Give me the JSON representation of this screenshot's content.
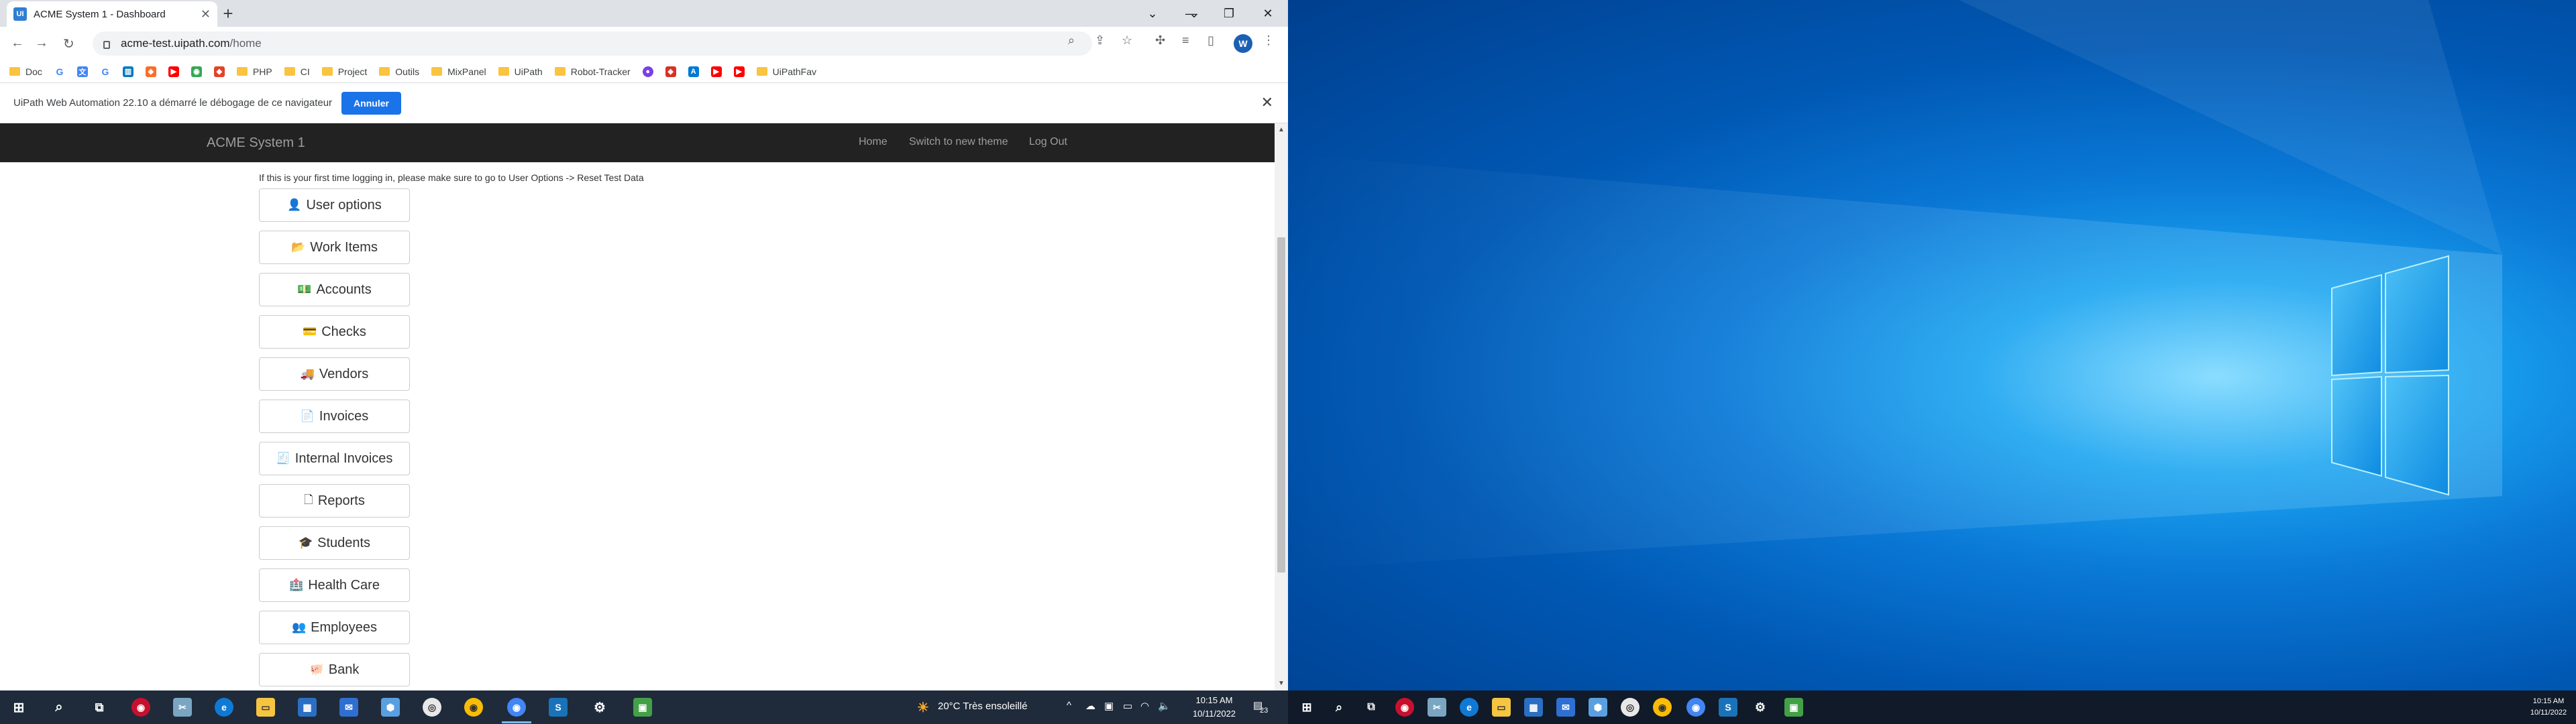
{
  "browser": {
    "tab_title": "ACME System 1 - Dashboard",
    "tab_icon": "UI",
    "url_host": "acme-test.uipath.com",
    "url_path": "/home",
    "avatar_letter": "W"
  },
  "bookmarks": [
    {
      "label": "Doc",
      "type": "folder"
    },
    {
      "label": "PHP",
      "type": "folder"
    },
    {
      "label": "CI",
      "type": "folder"
    },
    {
      "label": "Project",
      "type": "folder"
    },
    {
      "label": "Outils",
      "type": "folder"
    },
    {
      "label": "MixPanel",
      "type": "folder"
    },
    {
      "label": "UiPath",
      "type": "folder"
    },
    {
      "label": "Robot-Tracker",
      "type": "folder"
    },
    {
      "label": "UiPathFav",
      "type": "folder"
    }
  ],
  "infobar": {
    "message": "UiPath Web Automation 22.10 a démarré le débogage de ce navigateur",
    "button": "Annuler"
  },
  "acme": {
    "brand": "ACME System 1",
    "nav": [
      "Home",
      "Switch to new theme",
      "Log Out"
    ],
    "intro": "If this is your first time logging in, please make sure to go to User Options -> Reset Test Data",
    "menu": [
      {
        "label": "User options",
        "icon": "user-icon",
        "glyph": "👤"
      },
      {
        "label": "Work Items",
        "icon": "folder-open-icon",
        "glyph": "📂"
      },
      {
        "label": "Accounts",
        "icon": "money-icon",
        "glyph": "💵"
      },
      {
        "label": "Checks",
        "icon": "credit-card-icon",
        "glyph": "💳"
      },
      {
        "label": "Vendors",
        "icon": "truck-icon",
        "glyph": "🚚"
      },
      {
        "label": "Invoices",
        "icon": "invoice-icon",
        "glyph": "📄"
      },
      {
        "label": "Internal Invoices",
        "icon": "internal-invoice-icon",
        "glyph": "🧾"
      },
      {
        "label": "Reports",
        "icon": "file-icon",
        "glyph": "🗋"
      },
      {
        "label": "Students",
        "icon": "graduation-cap-icon",
        "glyph": "🎓"
      },
      {
        "label": "Health Care",
        "icon": "medkit-icon",
        "glyph": "🏥"
      },
      {
        "label": "Employees",
        "icon": "employee-icon",
        "glyph": "👥"
      },
      {
        "label": "Bank",
        "icon": "piggy-bank-icon",
        "glyph": "🐖"
      }
    ]
  },
  "taskbar_left": {
    "weather": "20°C  Très ensoleillé",
    "time": "10:15 AM",
    "date": "10/11/2022",
    "notifications": "23"
  },
  "taskbar_right": {
    "time": "10:15 AM",
    "date": "10/11/2022"
  },
  "colors": {
    "acme_nav_bg": "#222222",
    "annuler_blue": "#1a73e8",
    "taskbar": "#1f2b3a",
    "desktop_blue": "#0a78d6"
  }
}
